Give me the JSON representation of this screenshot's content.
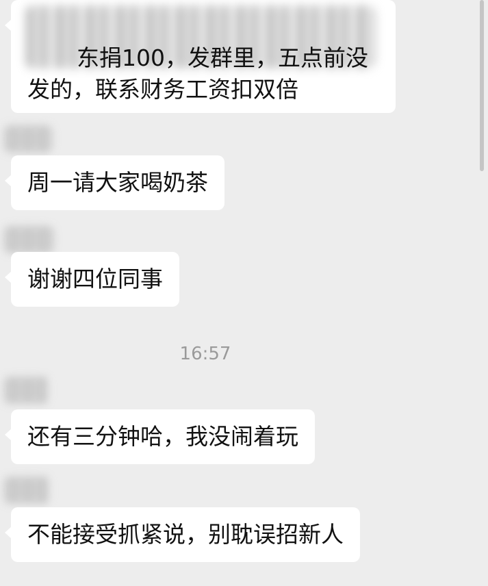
{
  "messages": [
    {
      "line1": "东捐100，发群里，五点前没",
      "line2": "发的，联系财务工资扣双倍"
    },
    {
      "text": "周一请大家喝奶茶"
    },
    {
      "text": "谢谢四位同事"
    },
    {
      "text": "还有三分钟哈，我没闹着玩"
    },
    {
      "text": "不能接受抓紧说，别耽误招新人"
    }
  ],
  "timestamp": "16:57",
  "colors": {
    "background": "#ededed",
    "bubble": "#ffffff",
    "text": "#111111",
    "timestamp": "#9a9a9a"
  }
}
